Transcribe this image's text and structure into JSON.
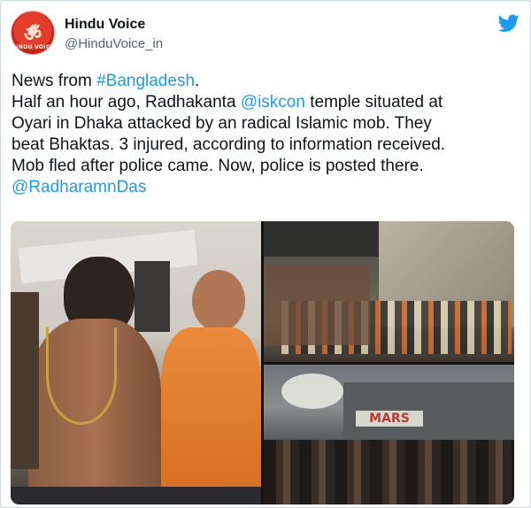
{
  "tweet": {
    "display_name": "Hindu Voice",
    "handle": "@HinduVoice_in",
    "avatar_text": "HINDU VOICE",
    "lines": [
      {
        "parts": [
          {
            "t": "News from ",
            "link": false
          },
          {
            "t": "#Bangladesh",
            "link": true
          },
          {
            "t": ".",
            "link": false
          }
        ]
      },
      {
        "parts": [
          {
            "t": "Half an hour ago, Radhakanta ",
            "link": false
          },
          {
            "t": "@iskcon",
            "link": true
          },
          {
            "t": " temple situated at",
            "link": false
          }
        ]
      },
      {
        "parts": [
          {
            "t": "Oyari in Dhaka attacked by an radical Islamic mob. They",
            "link": false
          }
        ]
      },
      {
        "parts": [
          {
            "t": "beat Bhaktas. 3 injured, according to information received.",
            "link": false
          }
        ]
      },
      {
        "parts": [
          {
            "t": "Mob fled after police came. Now, police is posted there.",
            "link": false
          }
        ]
      },
      {
        "parts": [
          {
            "t": "@RadharamnDas",
            "link": true
          }
        ]
      }
    ],
    "photo3_sign": "MARS"
  },
  "colors": {
    "link": "#1d9bf0",
    "twitter_blue": "#1d9bf0",
    "text": "#0f1419",
    "secondary": "#536471",
    "saffron": "#e07a2c"
  }
}
